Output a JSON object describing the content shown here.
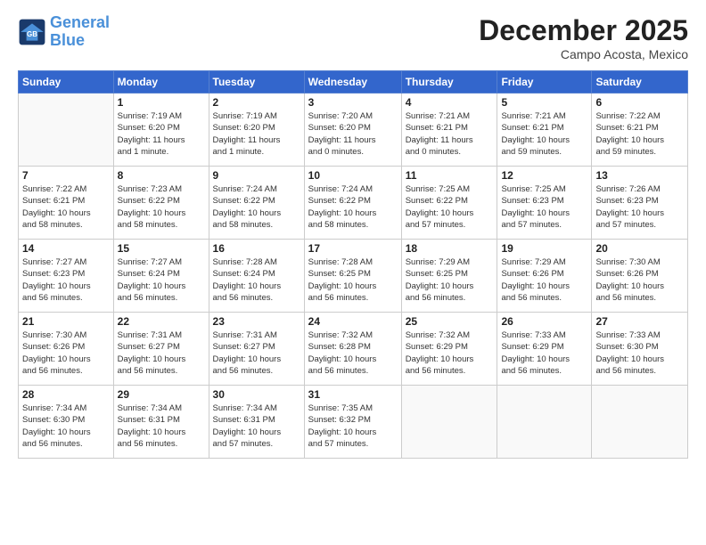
{
  "logo": {
    "line1": "General",
    "line2": "Blue"
  },
  "title": "December 2025",
  "subtitle": "Campo Acosta, Mexico",
  "days_of_week": [
    "Sunday",
    "Monday",
    "Tuesday",
    "Wednesday",
    "Thursday",
    "Friday",
    "Saturday"
  ],
  "weeks": [
    [
      {
        "num": "",
        "info": ""
      },
      {
        "num": "1",
        "info": "Sunrise: 7:19 AM\nSunset: 6:20 PM\nDaylight: 11 hours\nand 1 minute."
      },
      {
        "num": "2",
        "info": "Sunrise: 7:19 AM\nSunset: 6:20 PM\nDaylight: 11 hours\nand 1 minute."
      },
      {
        "num": "3",
        "info": "Sunrise: 7:20 AM\nSunset: 6:20 PM\nDaylight: 11 hours\nand 0 minutes."
      },
      {
        "num": "4",
        "info": "Sunrise: 7:21 AM\nSunset: 6:21 PM\nDaylight: 11 hours\nand 0 minutes."
      },
      {
        "num": "5",
        "info": "Sunrise: 7:21 AM\nSunset: 6:21 PM\nDaylight: 10 hours\nand 59 minutes."
      },
      {
        "num": "6",
        "info": "Sunrise: 7:22 AM\nSunset: 6:21 PM\nDaylight: 10 hours\nand 59 minutes."
      }
    ],
    [
      {
        "num": "7",
        "info": "Sunrise: 7:22 AM\nSunset: 6:21 PM\nDaylight: 10 hours\nand 58 minutes."
      },
      {
        "num": "8",
        "info": "Sunrise: 7:23 AM\nSunset: 6:22 PM\nDaylight: 10 hours\nand 58 minutes."
      },
      {
        "num": "9",
        "info": "Sunrise: 7:24 AM\nSunset: 6:22 PM\nDaylight: 10 hours\nand 58 minutes."
      },
      {
        "num": "10",
        "info": "Sunrise: 7:24 AM\nSunset: 6:22 PM\nDaylight: 10 hours\nand 58 minutes."
      },
      {
        "num": "11",
        "info": "Sunrise: 7:25 AM\nSunset: 6:22 PM\nDaylight: 10 hours\nand 57 minutes."
      },
      {
        "num": "12",
        "info": "Sunrise: 7:25 AM\nSunset: 6:23 PM\nDaylight: 10 hours\nand 57 minutes."
      },
      {
        "num": "13",
        "info": "Sunrise: 7:26 AM\nSunset: 6:23 PM\nDaylight: 10 hours\nand 57 minutes."
      }
    ],
    [
      {
        "num": "14",
        "info": "Sunrise: 7:27 AM\nSunset: 6:23 PM\nDaylight: 10 hours\nand 56 minutes."
      },
      {
        "num": "15",
        "info": "Sunrise: 7:27 AM\nSunset: 6:24 PM\nDaylight: 10 hours\nand 56 minutes."
      },
      {
        "num": "16",
        "info": "Sunrise: 7:28 AM\nSunset: 6:24 PM\nDaylight: 10 hours\nand 56 minutes."
      },
      {
        "num": "17",
        "info": "Sunrise: 7:28 AM\nSunset: 6:25 PM\nDaylight: 10 hours\nand 56 minutes."
      },
      {
        "num": "18",
        "info": "Sunrise: 7:29 AM\nSunset: 6:25 PM\nDaylight: 10 hours\nand 56 minutes."
      },
      {
        "num": "19",
        "info": "Sunrise: 7:29 AM\nSunset: 6:26 PM\nDaylight: 10 hours\nand 56 minutes."
      },
      {
        "num": "20",
        "info": "Sunrise: 7:30 AM\nSunset: 6:26 PM\nDaylight: 10 hours\nand 56 minutes."
      }
    ],
    [
      {
        "num": "21",
        "info": "Sunrise: 7:30 AM\nSunset: 6:26 PM\nDaylight: 10 hours\nand 56 minutes."
      },
      {
        "num": "22",
        "info": "Sunrise: 7:31 AM\nSunset: 6:27 PM\nDaylight: 10 hours\nand 56 minutes."
      },
      {
        "num": "23",
        "info": "Sunrise: 7:31 AM\nSunset: 6:27 PM\nDaylight: 10 hours\nand 56 minutes."
      },
      {
        "num": "24",
        "info": "Sunrise: 7:32 AM\nSunset: 6:28 PM\nDaylight: 10 hours\nand 56 minutes."
      },
      {
        "num": "25",
        "info": "Sunrise: 7:32 AM\nSunset: 6:29 PM\nDaylight: 10 hours\nand 56 minutes."
      },
      {
        "num": "26",
        "info": "Sunrise: 7:33 AM\nSunset: 6:29 PM\nDaylight: 10 hours\nand 56 minutes."
      },
      {
        "num": "27",
        "info": "Sunrise: 7:33 AM\nSunset: 6:30 PM\nDaylight: 10 hours\nand 56 minutes."
      }
    ],
    [
      {
        "num": "28",
        "info": "Sunrise: 7:34 AM\nSunset: 6:30 PM\nDaylight: 10 hours\nand 56 minutes."
      },
      {
        "num": "29",
        "info": "Sunrise: 7:34 AM\nSunset: 6:31 PM\nDaylight: 10 hours\nand 56 minutes."
      },
      {
        "num": "30",
        "info": "Sunrise: 7:34 AM\nSunset: 6:31 PM\nDaylight: 10 hours\nand 57 minutes."
      },
      {
        "num": "31",
        "info": "Sunrise: 7:35 AM\nSunset: 6:32 PM\nDaylight: 10 hours\nand 57 minutes."
      },
      {
        "num": "",
        "info": ""
      },
      {
        "num": "",
        "info": ""
      },
      {
        "num": "",
        "info": ""
      }
    ]
  ]
}
